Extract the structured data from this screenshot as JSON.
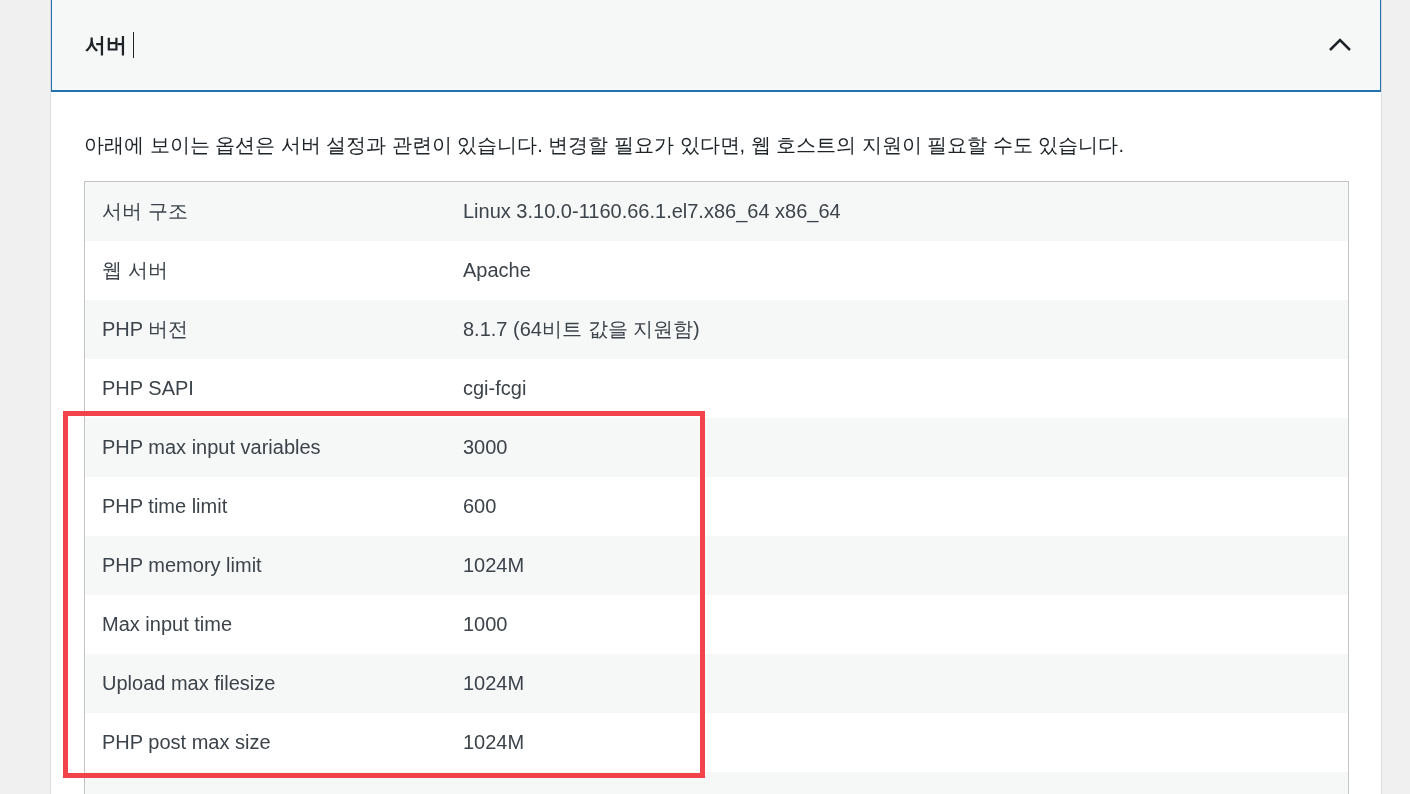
{
  "section": {
    "title": "서버",
    "expanded": true,
    "description": "아래에 보이는 옵션은 서버 설정과 관련이 있습니다. 변경할 필요가 있다면, 웹 호스트의 지원이 필요할 수도 있습니다."
  },
  "rows": [
    {
      "label": "서버 구조",
      "value": "Linux 3.10.0-1160.66.1.el7.x86_64 x86_64",
      "highlighted": false
    },
    {
      "label": "웹 서버",
      "value": "Apache",
      "highlighted": false
    },
    {
      "label": "PHP 버전",
      "value": "8.1.7 (64비트 값을 지원함)",
      "highlighted": false
    },
    {
      "label": "PHP SAPI",
      "value": "cgi-fcgi",
      "highlighted": false
    },
    {
      "label": "PHP max input variables",
      "value": "3000",
      "highlighted": true
    },
    {
      "label": "PHP time limit",
      "value": "600",
      "highlighted": true
    },
    {
      "label": "PHP memory limit",
      "value": "1024M",
      "highlighted": true
    },
    {
      "label": "Max input time",
      "value": "1000",
      "highlighted": true
    },
    {
      "label": "Upload max filesize",
      "value": "1024M",
      "highlighted": true
    },
    {
      "label": "PHP post max size",
      "value": "1024M",
      "highlighted": true
    }
  ]
}
